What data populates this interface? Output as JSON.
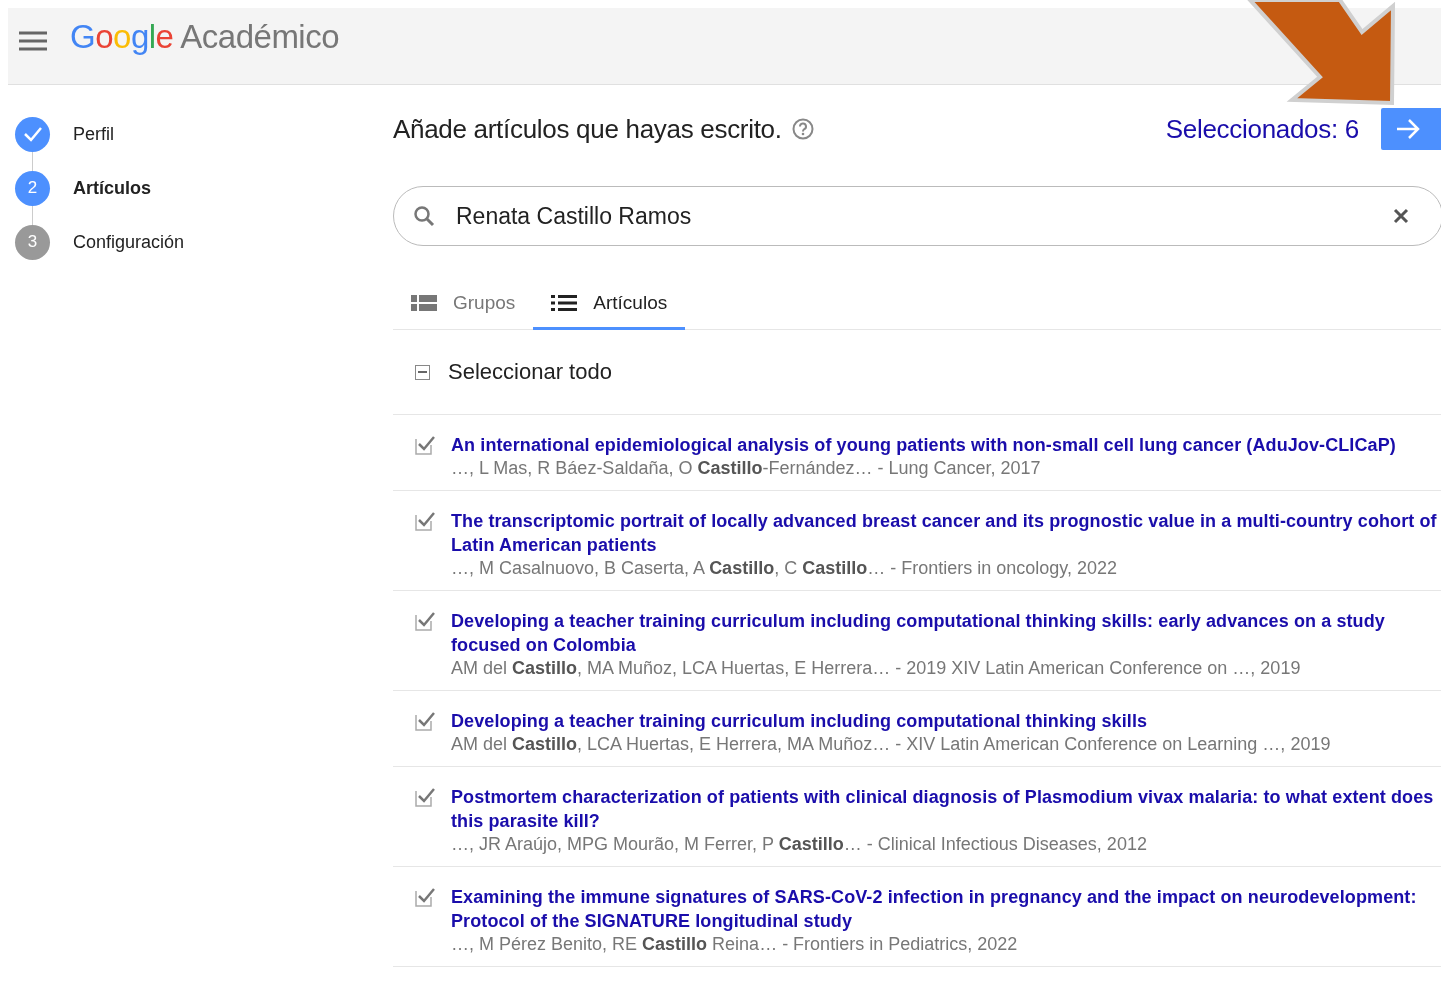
{
  "header": {
    "logo_brand": "Google",
    "logo_product": "Académico"
  },
  "steps": [
    {
      "label": "Perfil",
      "completed": true,
      "selected": false
    },
    {
      "label": "Artículos",
      "number": "2",
      "completed": false,
      "selected": true
    },
    {
      "label": "Configuración",
      "number": "3",
      "completed": false,
      "selected": false
    }
  ],
  "heading": "Añade artículos que hayas escrito.",
  "selected_count": "Seleccionados: 6",
  "search": {
    "value": "Renata Castillo Ramos"
  },
  "tabs": [
    {
      "label": "Grupos",
      "selected": false
    },
    {
      "label": "Artículos",
      "selected": true
    }
  ],
  "select_all": {
    "label": "Seleccionar todo",
    "indeterminate": true
  },
  "articles": [
    {
      "title": "An international epidemiological analysis of young patients with non-small cell lung cancer (AduJov-CLICaP)",
      "meta": "…, L Mas, R Báez-Saldaña, O **Castillo**-Fernández… - Lung Cancer, 2017",
      "checked": true
    },
    {
      "title": "The transcriptomic portrait of locally advanced breast cancer and its prognostic value in a multi-country cohort of Latin American patients",
      "meta": "…, M Casalnuovo, B Caserta, A **Castillo**, C **Castillo**… - Frontiers in oncology, 2022",
      "checked": true
    },
    {
      "title": "Developing a teacher training curriculum including computational thinking skills: early advances on a study focused on Colombia",
      "meta": "AM del **Castillo**, MA Muñoz, LCA Huertas, E Herrera… - 2019 XIV Latin American Conference on …, 2019",
      "checked": true
    },
    {
      "title": "Developing a teacher training curriculum including computational thinking skills",
      "meta": "AM del **Castillo**, LCA Huertas, E Herrera, MA Muñoz… - XIV Latin American Conference on Learning …, 2019",
      "checked": true
    },
    {
      "title": "Postmortem characterization of patients with clinical diagnosis of Plasmodium vivax malaria: to what extent does this parasite kill?",
      "meta": "…, JR Araújo, MPG Mourão, M Ferrer, P **Castillo**… - Clinical Infectious Diseases, 2012",
      "checked": true
    },
    {
      "title": "Examining the immune signatures of SARS-CoV-2 infection in pregnancy and the impact on neurodevelopment: Protocol of the SIGNATURE longitudinal study",
      "meta": "…, M Pérez Benito, RE **Castillo** Reina… - Frontiers in Pediatrics, 2022",
      "checked": true
    }
  ]
}
